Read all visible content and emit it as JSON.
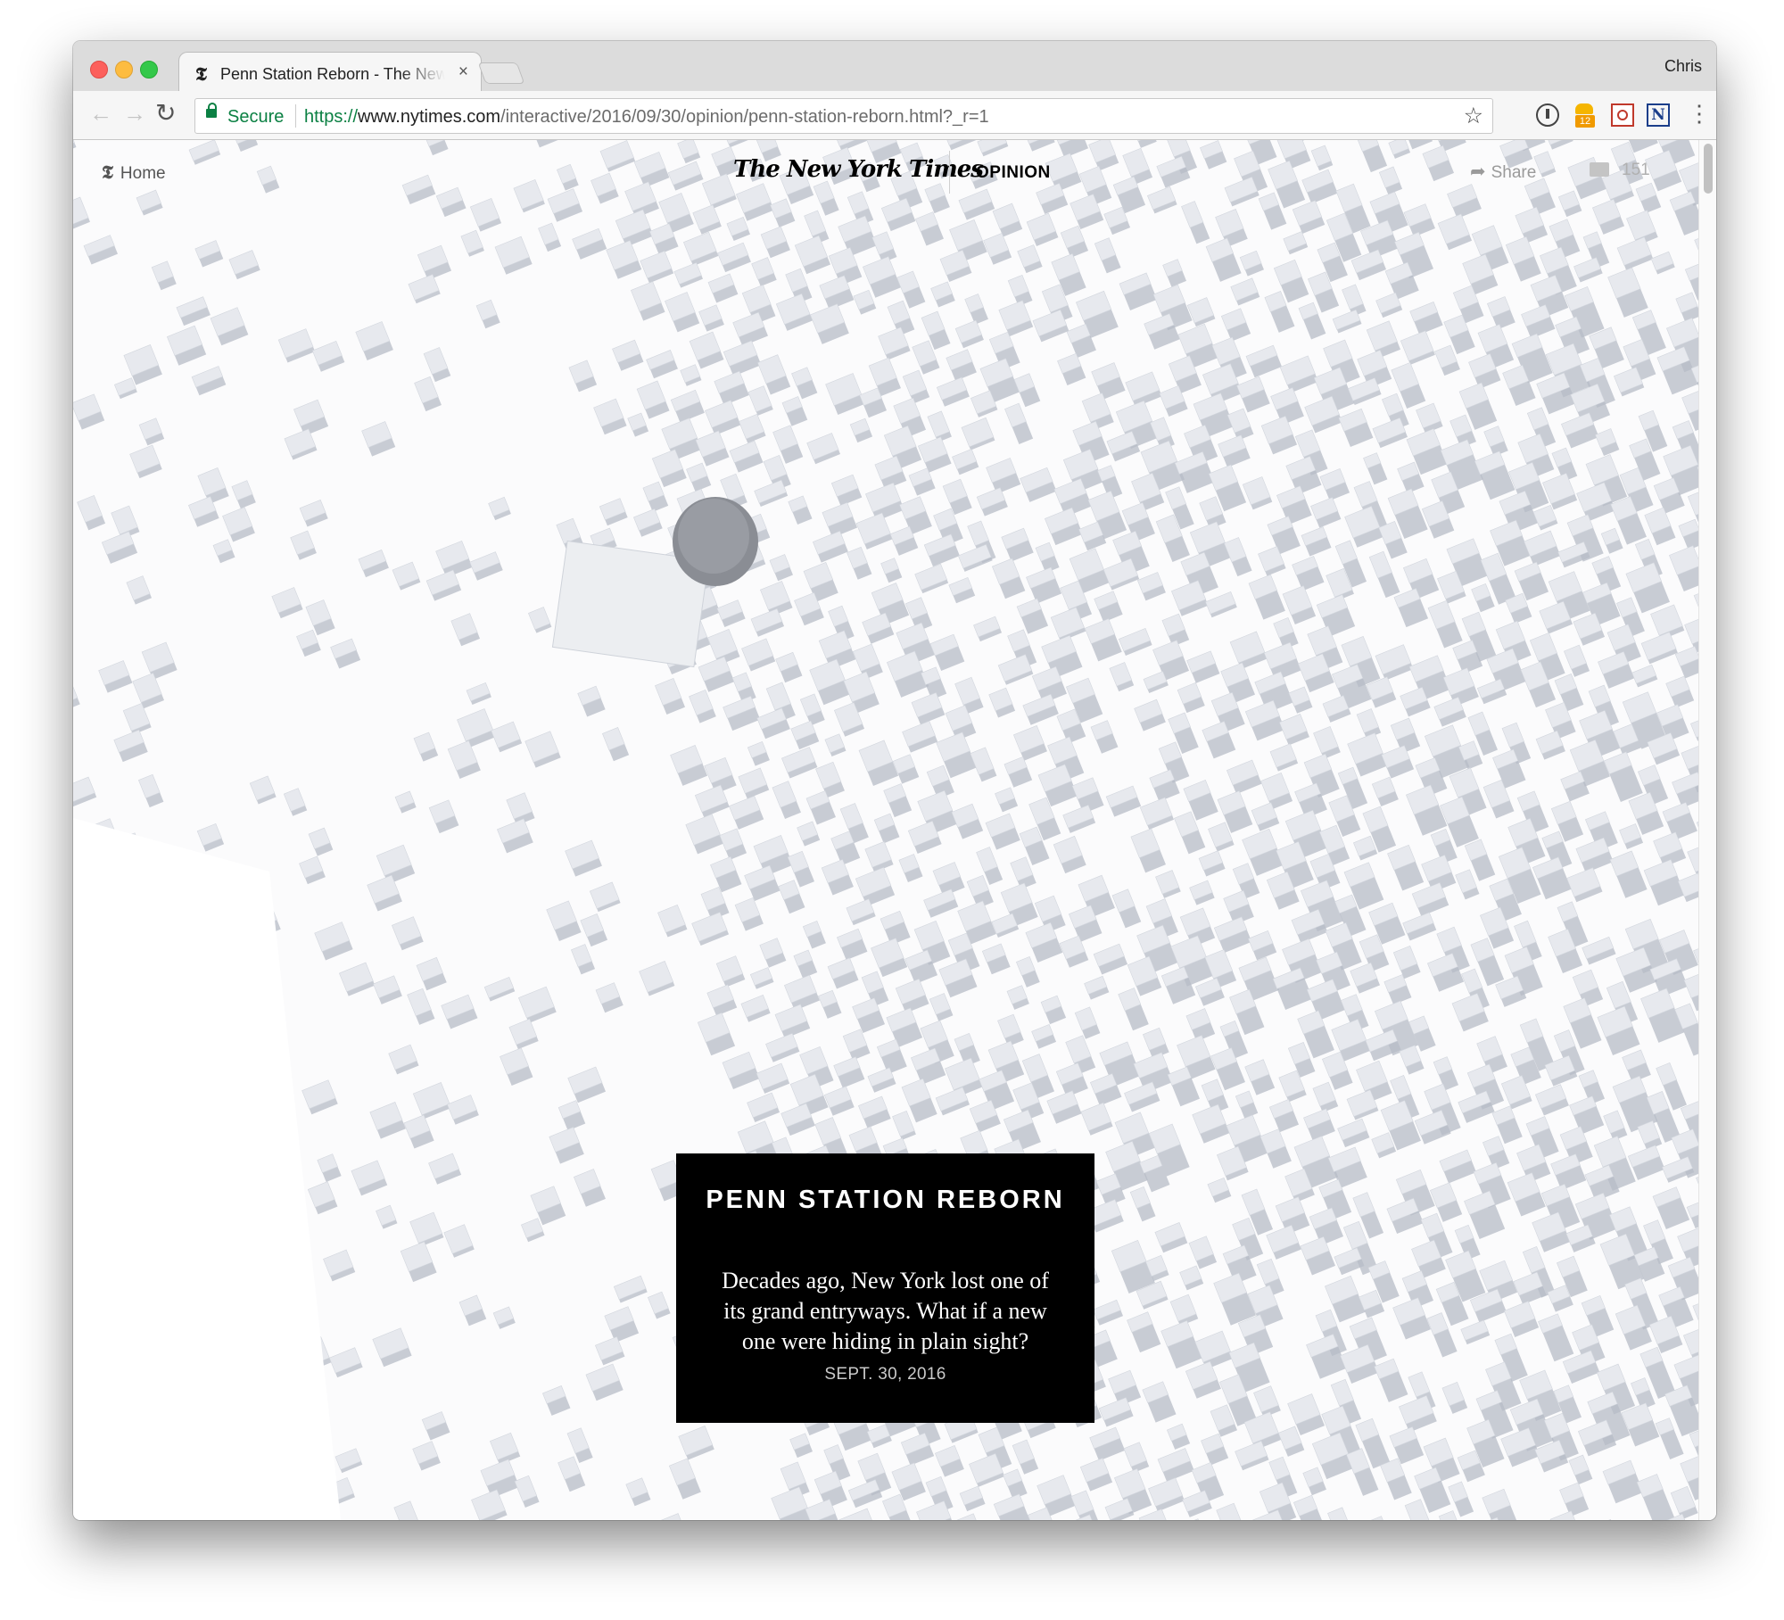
{
  "browser": {
    "tab_title": "Penn Station Reborn - The New York Times",
    "tab_favicon": "𝕿",
    "tab_close": "×",
    "profile_name": "Chris",
    "nav": {
      "back": "←",
      "forward": "→",
      "reload": "↻"
    },
    "secure_label": "Secure",
    "url_scheme": "https://",
    "url_host": "www.nytimes.com",
    "url_path": "/interactive/2016/09/30/opinion/penn-station-reborn.html?_r=1",
    "bookmark_star": "☆",
    "extensions": [
      "info-icon",
      "ghostery-icon",
      "screenshot-icon",
      "n-icon"
    ],
    "extension_badge_count": "12",
    "extension_n_label": "N",
    "menu": "⋮"
  },
  "header": {
    "home_icon": "𝕿",
    "home_label": "Home",
    "masthead": "The New York Times",
    "section": "OPINION",
    "share_icon": "➦",
    "share_label": "Share",
    "comments_count": "151"
  },
  "card": {
    "title": "PENN STATION REBORN",
    "dek": "Decades ago, New York lost one of its grand entryways. What if a new one were hiding in plain sight?",
    "date": "SEPT. 30, 2016"
  },
  "colors": {
    "card_background": "#000000",
    "secure_green": "#0b8043",
    "map_building": "#e7e9ee",
    "map_shadow": "#b7bcc7"
  }
}
